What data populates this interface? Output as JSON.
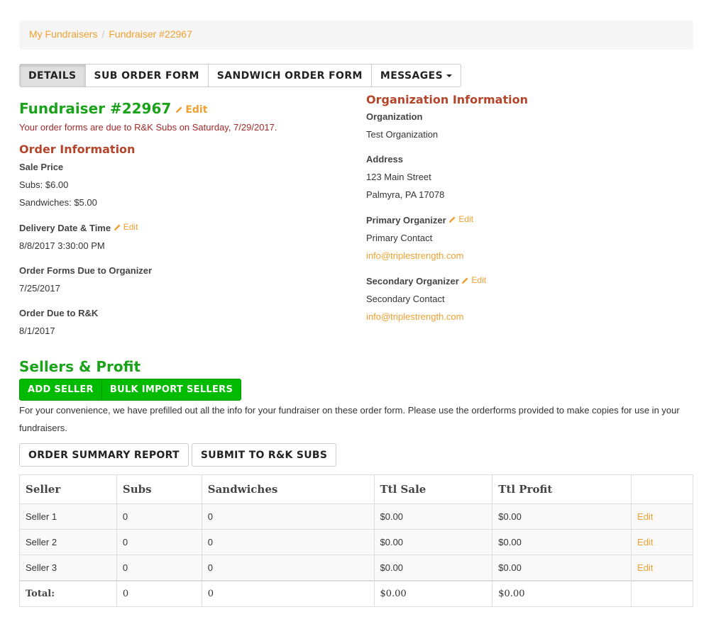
{
  "breadcrumb": {
    "items": [
      {
        "label": "My Fundraisers"
      },
      {
        "label": "Fundraiser #22967"
      }
    ],
    "separator": "/"
  },
  "tabs": [
    {
      "label": "DETAILS",
      "active": true
    },
    {
      "label": "SUB ORDER FORM",
      "active": false
    },
    {
      "label": "SANDWICH ORDER FORM",
      "active": false
    },
    {
      "label": "MESSAGES",
      "active": false,
      "dropdown": true
    }
  ],
  "fundraiser": {
    "title": "Fundraiser #22967",
    "edit_label": "Edit",
    "due_note": "Your order forms are due to R&K Subs on Saturday, 7/29/2017."
  },
  "order_info": {
    "heading": "Order Information",
    "sale_price_label": "Sale Price",
    "subs_price": "Subs: $6.00",
    "sandwiches_price": "Sandwiches: $5.00",
    "delivery_label": "Delivery Date & Time",
    "delivery_edit_label": "Edit",
    "delivery_value": "8/8/2017 3:30:00 PM",
    "forms_due_label": "Order Forms Due to Organizer",
    "forms_due_value": "7/25/2017",
    "order_due_label": "Order Due to R&K",
    "order_due_value": "8/1/2017"
  },
  "org_info": {
    "heading": "Organization Information",
    "org_label": "Organization",
    "org_value": "Test Organization",
    "address_label": "Address",
    "address_line1": "123 Main Street",
    "address_line2": "Palmyra, PA 17078",
    "primary_label": "Primary Organizer",
    "primary_edit_label": "Edit",
    "primary_name": "Primary Contact",
    "primary_email": "info@triplestrength.com",
    "secondary_label": "Secondary Organizer",
    "secondary_edit_label": "Edit",
    "secondary_name": "Secondary Contact",
    "secondary_email": "info@triplestrength.com"
  },
  "sellers": {
    "heading": "Sellers & Profit",
    "add_seller_label": "ADD SELLER",
    "bulk_import_label": "BULK IMPORT SELLERS",
    "convenience_note": "For your convenience, we have prefilled out all the info for your fundraiser on these order form. Please use the orderforms provided to make copies for use in your fundraisers.",
    "order_summary_label": "ORDER SUMMARY REPORT",
    "submit_label": "SUBMIT TO R&K SUBS"
  },
  "table": {
    "headers": [
      "Seller",
      "Subs",
      "Sandwiches",
      "Ttl Sale",
      "Ttl Profit",
      ""
    ],
    "rows": [
      {
        "seller": "Seller 1",
        "subs": "0",
        "sandwiches": "0",
        "ttl_sale": "$0.00",
        "ttl_profit": "$0.00",
        "edit": "Edit"
      },
      {
        "seller": "Seller 2",
        "subs": "0",
        "sandwiches": "0",
        "ttl_sale": "$0.00",
        "ttl_profit": "$0.00",
        "edit": "Edit"
      },
      {
        "seller": "Seller 3",
        "subs": "0",
        "sandwiches": "0",
        "ttl_sale": "$0.00",
        "ttl_profit": "$0.00",
        "edit": "Edit"
      }
    ],
    "total": {
      "label": "Total:",
      "subs": "0",
      "sandwiches": "0",
      "ttl_sale": "$0.00",
      "ttl_profit": "$0.00"
    }
  },
  "colors": {
    "accent_orange": "#f0a030",
    "heading_green": "#1aa31a",
    "heading_red": "#b5452a",
    "button_green": "#00bb00"
  },
  "icons": {
    "edit": "pencil-icon",
    "dropdown": "caret-down-icon"
  }
}
